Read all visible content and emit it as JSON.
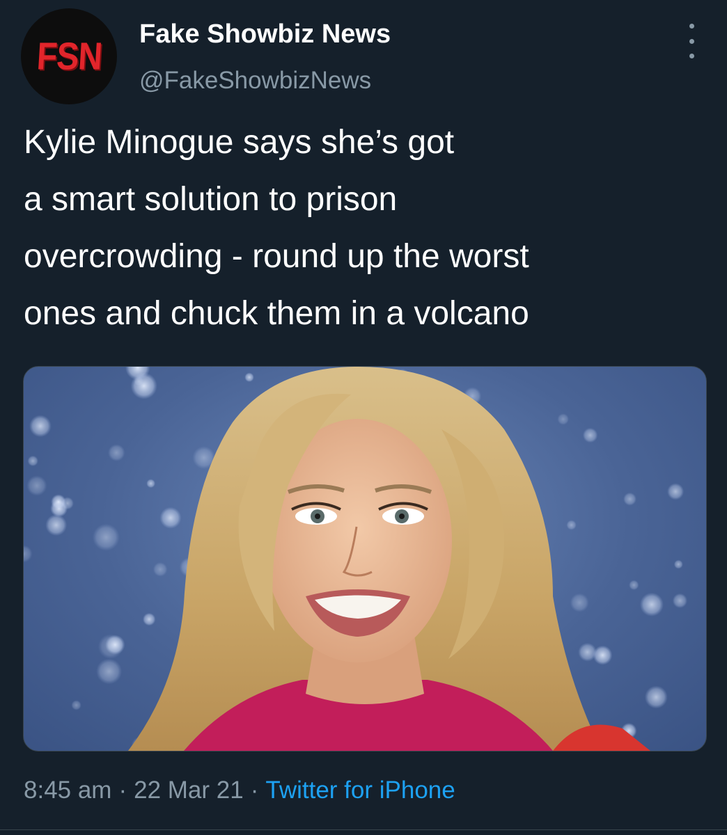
{
  "account": {
    "avatar_text": "FSN",
    "display_name": "Fake Showbiz News",
    "handle": "@FakeShowbizNews"
  },
  "tweet": {
    "lines": [
      "Kylie Minogue says she’s got",
      "a smart solution to prison",
      "overcrowding - round up the worst",
      "ones and chuck them in a volcano"
    ]
  },
  "meta": {
    "time": "8:45 am",
    "separator": "·",
    "date": "22 Mar 21",
    "source": "Twitter for iPhone"
  },
  "icons": {
    "more": "more-vertical-icon"
  },
  "colors": {
    "background": "#15202b",
    "secondary_text": "#8899a6",
    "link": "#1da1f2",
    "avatar_brand": "#e1252b"
  }
}
